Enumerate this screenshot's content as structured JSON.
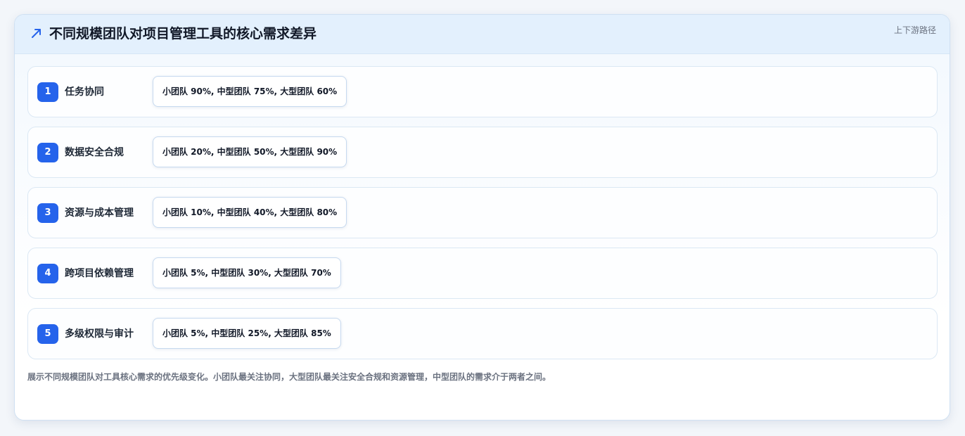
{
  "header": {
    "icon": "trend-arrow-icon",
    "title": "不同规模团队对项目管理工具的核心需求差异",
    "tag": "上下游路径"
  },
  "rows": [
    {
      "number": "1",
      "label": "任务协同",
      "detail": "小团队 90%, 中型团队 75%, 大型团队 60%"
    },
    {
      "number": "2",
      "label": "数据安全合规",
      "detail": "小团队 20%, 中型团队 50%, 大型团队 90%"
    },
    {
      "number": "3",
      "label": "资源与成本管理",
      "detail": "小团队 10%, 中型团队 40%, 大型团队 80%"
    },
    {
      "number": "4",
      "label": "跨项目依赖管理",
      "detail": "小团队 5%, 中型团队 30%, 大型团队 70%"
    },
    {
      "number": "5",
      "label": "多级权限与审计",
      "detail": "小团队 5%, 中型团队 25%, 大型团队 85%"
    }
  ],
  "footer": {
    "note": "展示不同规模团队对工具核心需求的优先级变化。小团队最关注协同，大型团队最关注安全合规和资源管理，中型团队的需求介于两者之间。"
  },
  "colors": {
    "accent": "#2563eb",
    "header_bg": "#e3f0fd",
    "border": "#cfe0f2"
  }
}
